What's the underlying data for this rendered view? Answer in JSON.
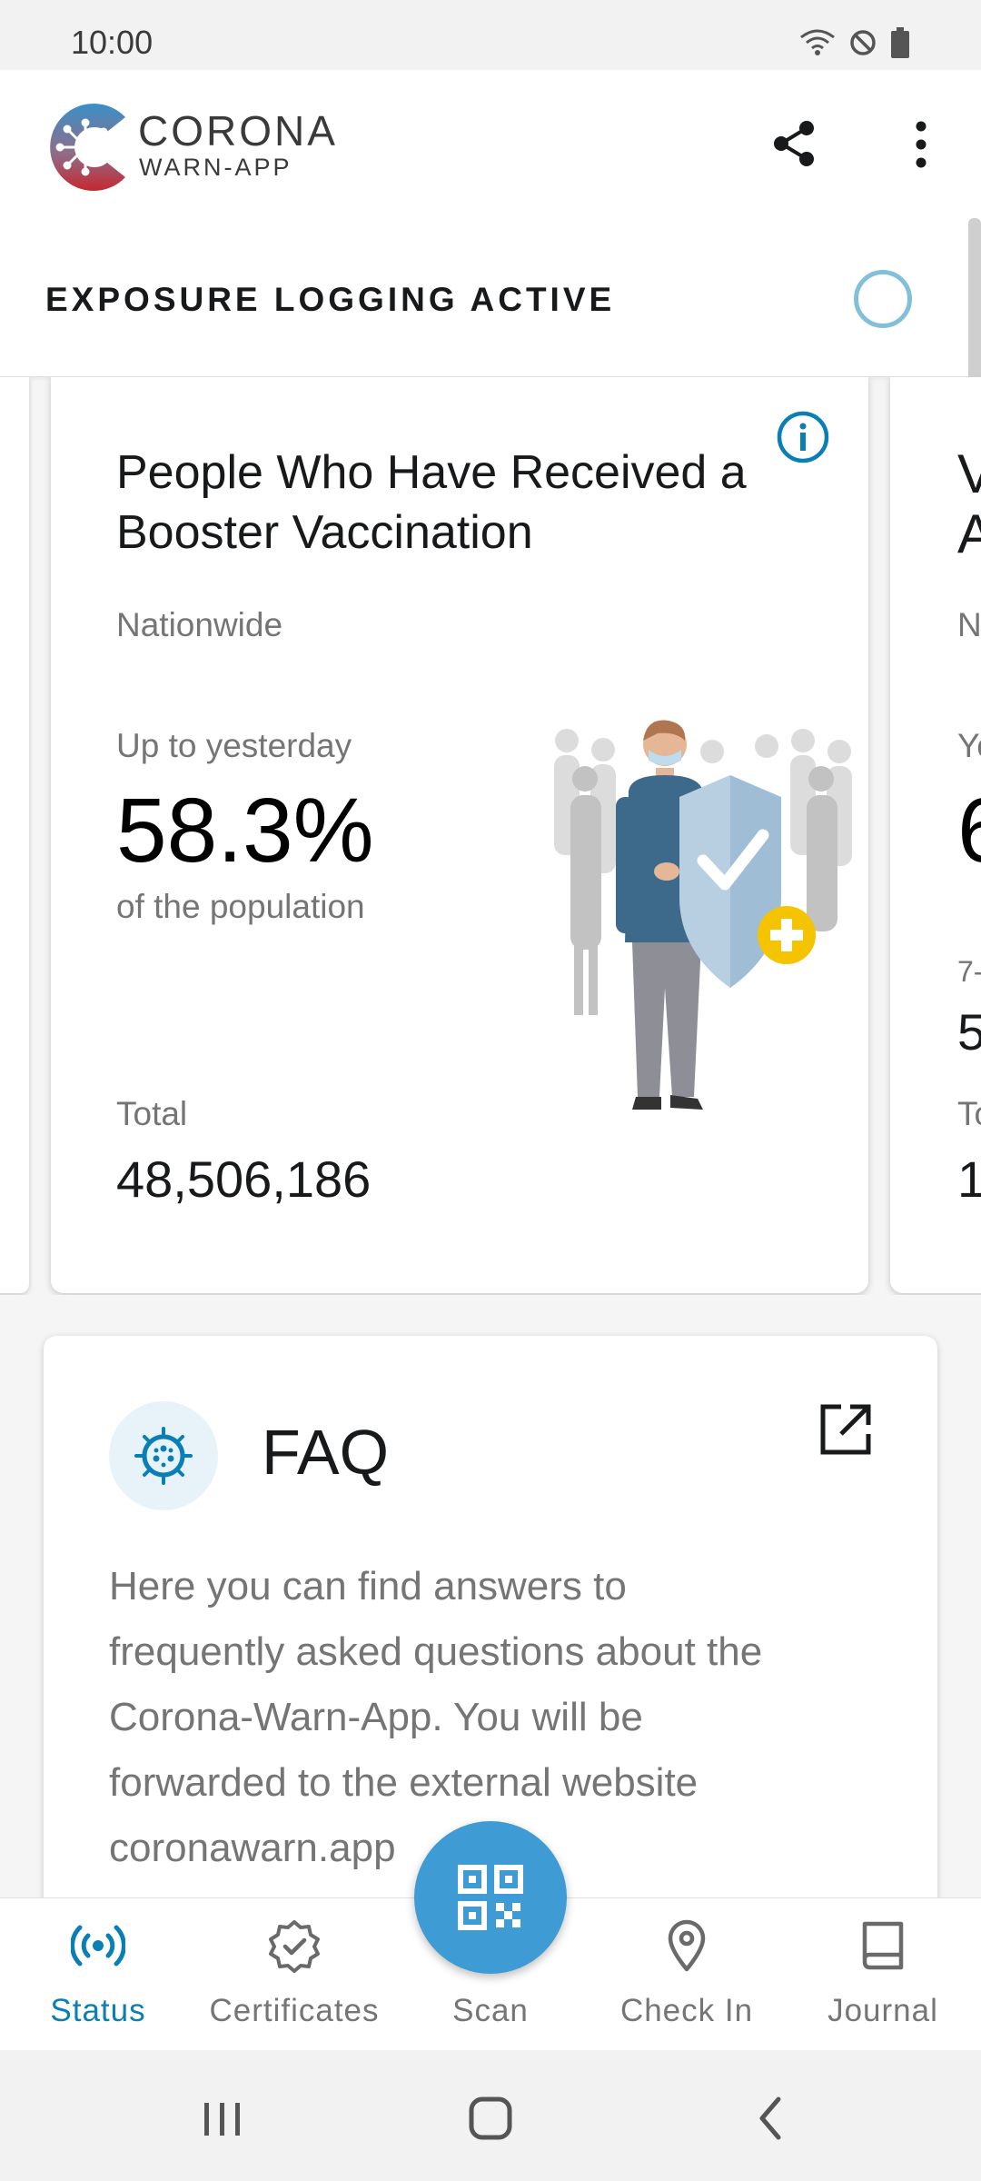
{
  "status_bar": {
    "time": "10:00"
  },
  "app_bar": {
    "logo_line1": "CORONA",
    "logo_line2": "WARN-APP"
  },
  "exposure": {
    "label": "EXPOSURE LOGGING ACTIVE"
  },
  "stats_card": {
    "title": "People Who Have Received a Booster Vaccination",
    "region": "Nationwide",
    "period": "Up to yesterday",
    "value": "58.3%",
    "subtext": "of the population",
    "total_label": "Total",
    "total_value": "48,506,186"
  },
  "next_card_peek": [
    "V",
    "A",
    "N",
    "Ye",
    "6",
    "7-",
    "5",
    "To",
    "1"
  ],
  "faq": {
    "title": "FAQ",
    "description": "Here you can find answers to frequently asked questions about the Corona-Warn-App. You will be forwarded to the external website coronawarn.app"
  },
  "bottom_nav": {
    "items": [
      {
        "label": "Status",
        "icon": "radio-waves-icon",
        "active": true
      },
      {
        "label": "Certificates",
        "icon": "badge-check-icon",
        "active": false
      },
      {
        "label": "Scan",
        "icon": "qr-code-icon",
        "active": false
      },
      {
        "label": "Check In",
        "icon": "location-pin-icon",
        "active": false
      },
      {
        "label": "Journal",
        "icon": "book-icon",
        "active": false
      }
    ]
  },
  "colors": {
    "accent": "#0a7fb5",
    "fab": "#3f9bd3",
    "ring": "#82bfd8",
    "booster_yellow": "#f5c400",
    "muted_text": "#757575"
  }
}
